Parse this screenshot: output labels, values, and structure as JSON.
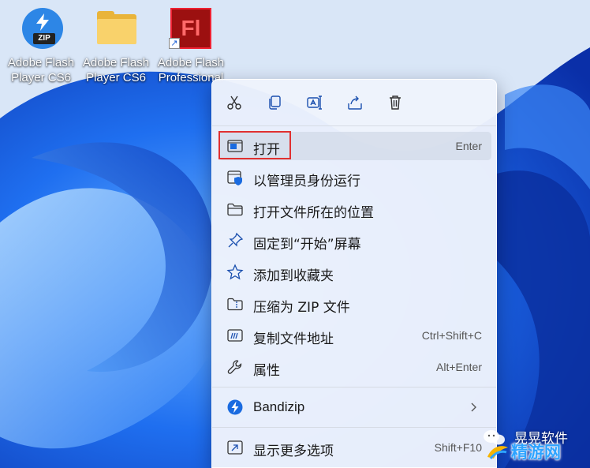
{
  "desktop": {
    "icons": [
      {
        "label_line1": "Adobe Flash",
        "label_line2": "Player CS6",
        "icon": "bandizip-zip-icon"
      },
      {
        "label_line1": "Adobe Flash",
        "label_line2": "Player CS6",
        "icon": "folder-icon"
      },
      {
        "label_line1": "Adobe Flash",
        "label_line2": "Professional",
        "icon": "flash-professional-icon",
        "badge": "Fl"
      }
    ]
  },
  "context_menu": {
    "toolbar": [
      {
        "icon": "cut-icon"
      },
      {
        "icon": "copy-icon"
      },
      {
        "icon": "rename-icon"
      },
      {
        "icon": "share-icon"
      },
      {
        "icon": "delete-icon"
      }
    ],
    "items": [
      {
        "label": "打开",
        "accelerator": "Enter",
        "icon": "open-window-icon"
      },
      {
        "label": "以管理员身份运行",
        "accelerator": "",
        "icon": "admin-shield-icon"
      },
      {
        "label": "打开文件所在的位置",
        "accelerator": "",
        "icon": "folder-outline-icon"
      },
      {
        "label": "固定到“开始”屏幕",
        "accelerator": "",
        "icon": "pin-icon"
      },
      {
        "label": "添加到收藏夹",
        "accelerator": "",
        "icon": "star-icon"
      },
      {
        "label": "压缩为 ZIP 文件",
        "accelerator": "",
        "icon": "zip-archive-icon"
      },
      {
        "label": "复制文件地址",
        "accelerator": "Ctrl+Shift+C",
        "icon": "copy-path-icon"
      },
      {
        "label": "属性",
        "accelerator": "Alt+Enter",
        "icon": "wrench-icon"
      }
    ],
    "bandizip": {
      "label": "Bandizip",
      "icon": "bandizip-icon"
    },
    "more": {
      "label": "显示更多选项",
      "accelerator": "Shift+F10",
      "icon": "more-options-icon"
    }
  },
  "watermark": {
    "line1": "晃晃软件",
    "line2": "精游网"
  },
  "colors": {
    "accent": "#0067c0",
    "highlight_border": "#e03030",
    "wallpaper": "#0d4fd8"
  }
}
